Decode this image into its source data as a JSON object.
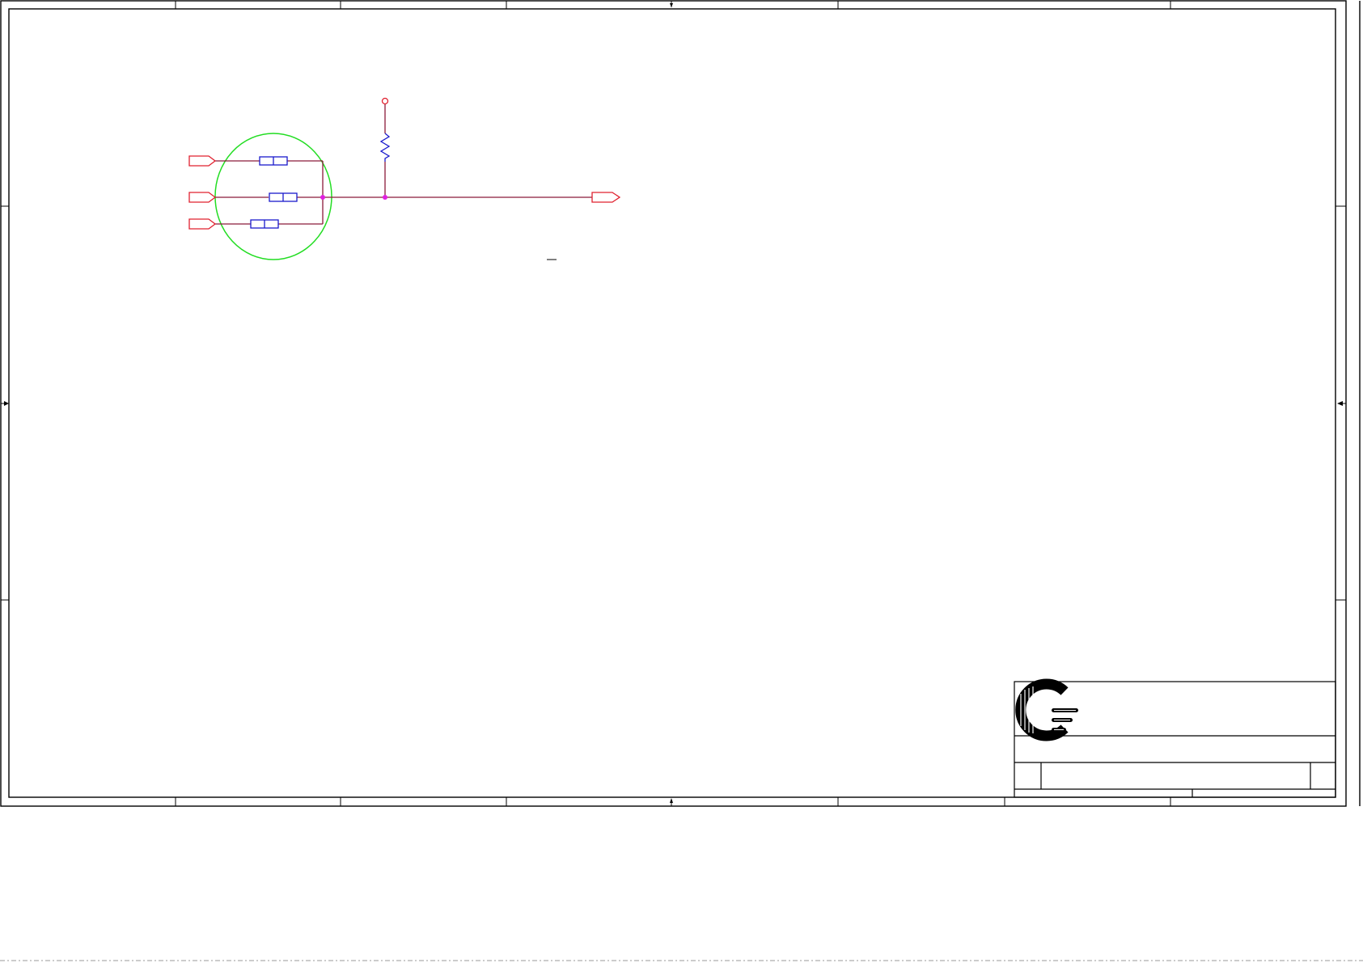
{
  "schematic": {
    "components": {
      "fuses": [
        {
          "id": "fuse-top",
          "label": ""
        },
        {
          "id": "fuse-middle",
          "label": ""
        },
        {
          "id": "fuse-bottom",
          "label": ""
        }
      ],
      "resistor": {
        "id": "pullup-resistor",
        "label": ""
      },
      "input_ports": [
        {
          "id": "input-port-1",
          "label": ""
        },
        {
          "id": "input-port-2",
          "label": ""
        },
        {
          "id": "input-port-3",
          "label": ""
        }
      ],
      "output_port": {
        "id": "output-port",
        "label": ""
      },
      "power_terminal": {
        "id": "power-terminal",
        "label": ""
      },
      "overbar_mark": "—"
    },
    "colors": {
      "wire": "#8b1a3a",
      "port": "#e0212f",
      "component": "#1a1acc",
      "junction": "#e020e0",
      "highlight": "#22dd22",
      "frame": "#000000"
    }
  },
  "title_block": {
    "logo_icon": "company-logo",
    "title": "",
    "document_number": "",
    "size": "",
    "revision": "",
    "date": "",
    "sheet": ""
  }
}
